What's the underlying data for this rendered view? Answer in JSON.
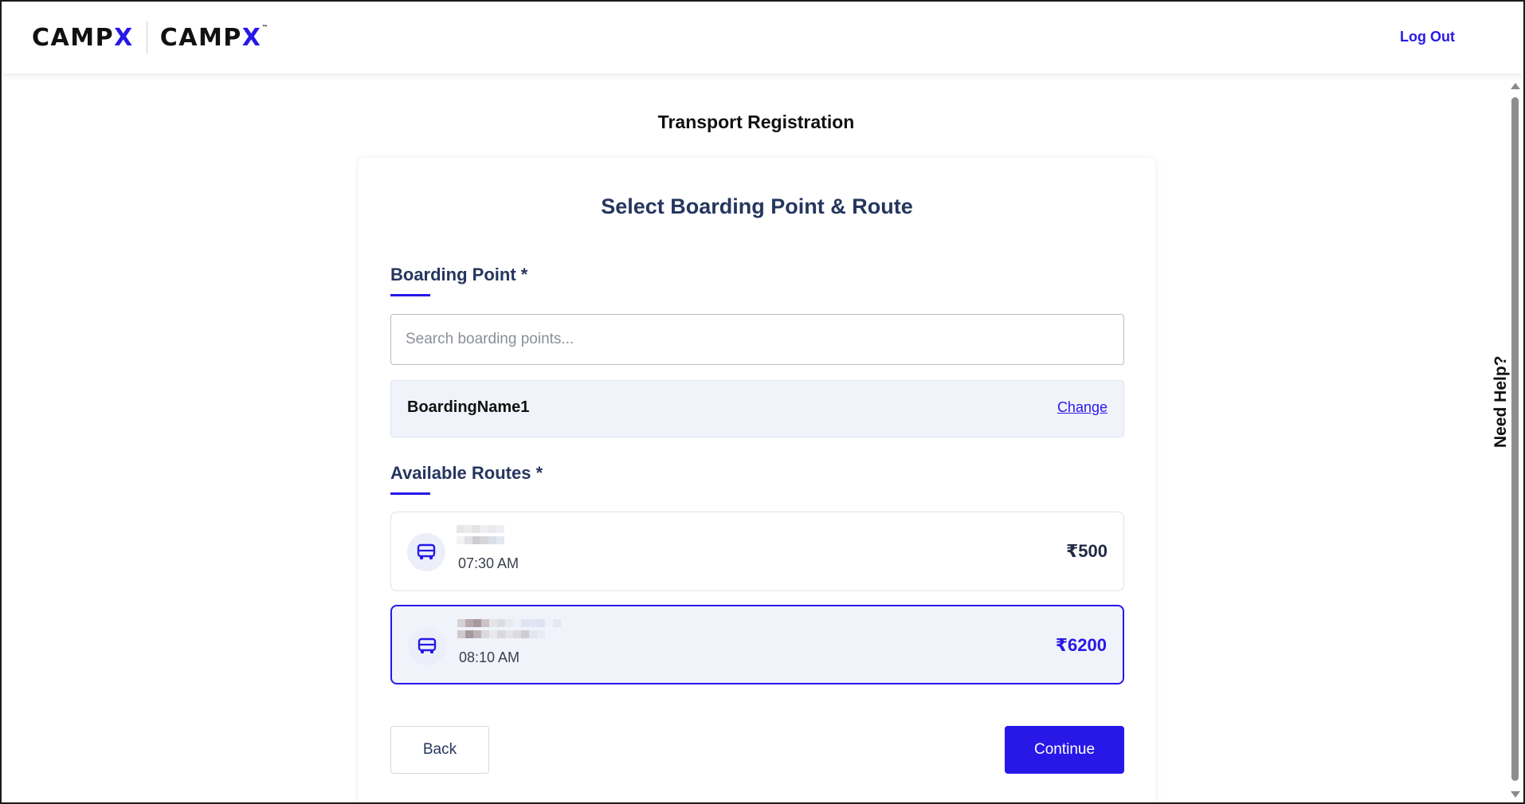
{
  "header": {
    "logo_primary": "CAMPX",
    "logo_secondary": "CAMPX",
    "logout_label": "Log Out"
  },
  "page": {
    "title": "Transport Registration",
    "need_help_label": "Need Help?"
  },
  "form": {
    "title": "Select Boarding Point & Route",
    "boarding_label": "Boarding Point *",
    "search_placeholder": "Search boarding points...",
    "selected_boarding_point": "BoardingName1",
    "change_label": "Change",
    "routes_label": "Available Routes *",
    "routes": [
      {
        "time": "07:30 AM",
        "price": "₹500",
        "selected": false,
        "icon": "bus-icon"
      },
      {
        "time": "08:10 AM",
        "price": "₹6200",
        "selected": true,
        "icon": "bus-icon"
      }
    ],
    "back_label": "Back",
    "continue_label": "Continue"
  },
  "colors": {
    "accent": "#2718e8",
    "heading": "#25365e",
    "selected_bg": "#f1f3fb"
  }
}
